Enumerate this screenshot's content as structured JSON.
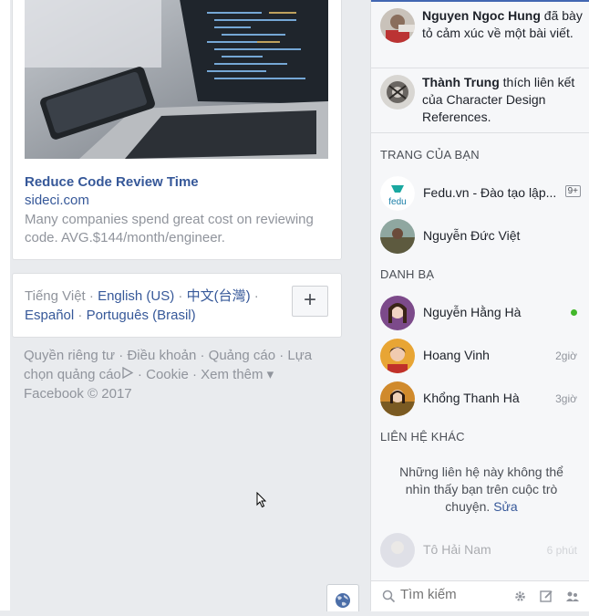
{
  "ad": {
    "title": "Reduce Code Review Time",
    "domain": "sideci.com",
    "description": "Many companies spend great cost on reviewing code. AVG.$144/month/engineer."
  },
  "languages": {
    "current": "Tiếng Việt",
    "links": [
      "English (US)",
      "中文(台灣)",
      "Español",
      "Português (Brasil)"
    ],
    "add_label": "+"
  },
  "footer": {
    "links": [
      "Quyền riêng tư",
      "Điều khoản",
      "Quảng cáo",
      "Lựa chọn quảng cáo",
      "Cookie",
      "Xem thêm"
    ],
    "copyright": "Facebook © 2017"
  },
  "ticker": [
    {
      "name": "Nguyen Ngoc Hung",
      "action": "đã bày tỏ cảm xúc về một bài viết."
    },
    {
      "name": "Thành Trung",
      "action": "thích liên kết của Character Design References."
    }
  ],
  "pages_section": {
    "title": "TRANG CỦA BẠN",
    "items": [
      {
        "name": "Fedu.vn - Đào tạo lập...",
        "badge": "9+",
        "logo_text": "fedu"
      },
      {
        "name": "Nguyễn Đức Việt"
      }
    ]
  },
  "contacts_section": {
    "title": "DANH BẠ",
    "items": [
      {
        "name": "Nguyễn Hằng Hà",
        "time": ""
      },
      {
        "name": "Hoang Vinh",
        "time": "2giờ"
      },
      {
        "name": "Khổng Thanh Hà",
        "time": "3giờ"
      }
    ]
  },
  "other_section": {
    "title": "LIÊN HỆ KHÁC",
    "message": "Những liên hệ này không thể nhìn thấy bạn trên cuộc trò chuyện.",
    "link": "Sửa",
    "faded_contact": {
      "name": "Tô Hải Nam",
      "time": "6 phút"
    }
  },
  "search": {
    "placeholder": "Tìm kiếm"
  },
  "colors": {
    "link": "#365899",
    "online": "#42b72a",
    "brand": "#4267b2"
  }
}
